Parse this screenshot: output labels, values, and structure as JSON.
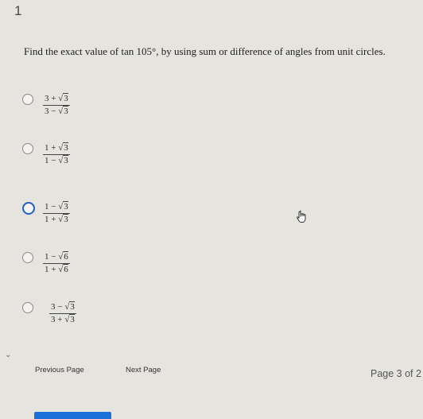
{
  "question_number": "1",
  "question_text": "Find the exact value of tan 105°, by using sum or difference of angles from unit circles.",
  "options": [
    {
      "num_a": "3",
      "num_op": "+",
      "num_root": "3",
      "den_a": "3",
      "den_op": "−",
      "den_root": "3",
      "selected": false
    },
    {
      "num_a": "1",
      "num_op": "+",
      "num_root": "3",
      "den_a": "1",
      "den_op": "−",
      "den_root": "3",
      "selected": false
    },
    {
      "num_a": "1",
      "num_op": "−",
      "num_root": "3",
      "den_a": "1",
      "den_op": "+",
      "den_root": "3",
      "selected": true
    },
    {
      "num_a": "1",
      "num_op": "−",
      "num_root": "6",
      "den_a": "1",
      "den_op": "+",
      "den_root": "6",
      "selected": false
    },
    {
      "num_a": "3",
      "num_op": "−",
      "num_root": "3",
      "den_a": "3",
      "den_op": "+",
      "den_root": "3",
      "selected": false
    }
  ],
  "nav": {
    "previous_label": "Previous Page",
    "next_label": "Next Page",
    "page_indicator": "Page 3 of 2"
  },
  "colors": {
    "selected_radio": "#1f5fbf",
    "bottom_button": "#1a6fd8"
  },
  "icons": {
    "expand": "chevron-down-icon",
    "cursor": "hand-pointer-icon"
  }
}
